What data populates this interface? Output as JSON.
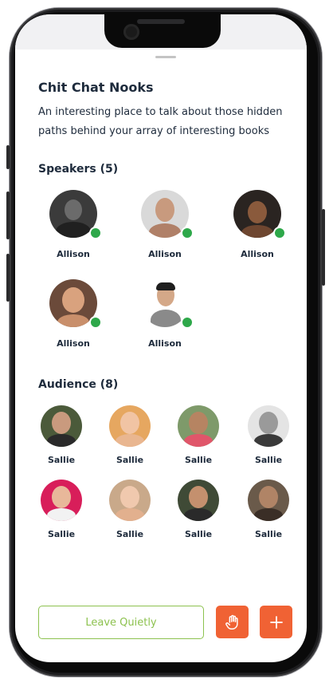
{
  "room": {
    "title": "Chit Chat Nooks",
    "description": "An interesting place to talk about those hidden paths behind your array of interesting books"
  },
  "speakers": {
    "heading": "Speakers (5)",
    "people": [
      {
        "name": "Allison",
        "online": true
      },
      {
        "name": "Allison",
        "online": true
      },
      {
        "name": "Allison",
        "online": true
      },
      {
        "name": "Allison",
        "online": true
      },
      {
        "name": "Allison",
        "online": true
      }
    ]
  },
  "audience": {
    "heading": "Audience (8)",
    "people": [
      {
        "name": "Sallie"
      },
      {
        "name": "Sallie"
      },
      {
        "name": "Sallie"
      },
      {
        "name": "Sallie"
      },
      {
        "name": "Sallie"
      },
      {
        "name": "Sallie"
      },
      {
        "name": "Sallie"
      },
      {
        "name": "Sallie"
      }
    ]
  },
  "actions": {
    "leave_label": "Leave Quietly",
    "raise_hand_icon": "raised-hand-icon",
    "add_icon": "plus-icon"
  },
  "colors": {
    "accent_orange": "#f06234",
    "leave_green": "#8dc24f",
    "online_green": "#2ea84a",
    "text_dark": "#1e2b3c"
  }
}
